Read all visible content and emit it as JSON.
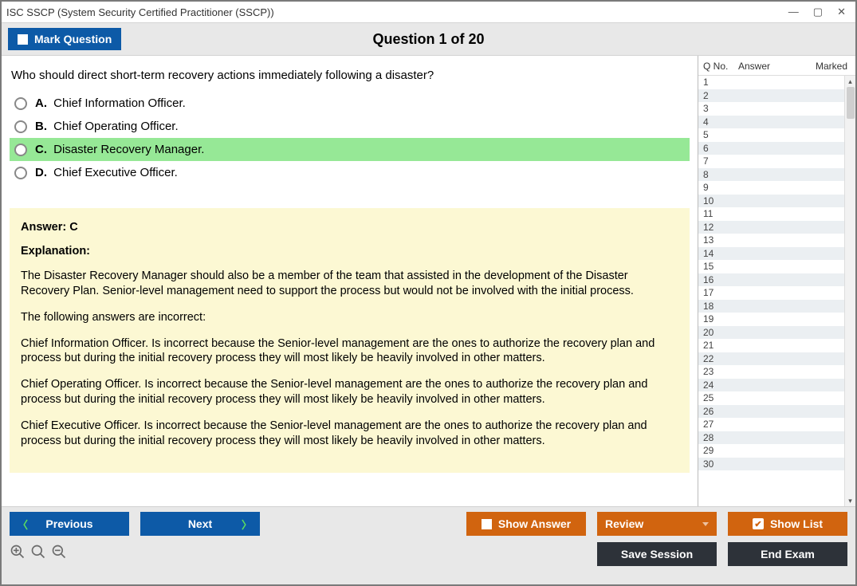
{
  "window": {
    "title": "ISC SSCP (System Security Certified Practitioner (SSCP))"
  },
  "toolbar": {
    "mark_label": "Mark Question",
    "header": "Question 1 of 20"
  },
  "question": {
    "text": "Who should direct short-term recovery actions immediately following a disaster?",
    "options": [
      {
        "letter": "A.",
        "text": "Chief Information Officer.",
        "highlight": false
      },
      {
        "letter": "B.",
        "text": "Chief Operating Officer.",
        "highlight": false
      },
      {
        "letter": "C.",
        "text": "Disaster Recovery Manager.",
        "highlight": true
      },
      {
        "letter": "D.",
        "text": "Chief Executive Officer.",
        "highlight": false
      }
    ]
  },
  "answer_panel": {
    "answer_line": "Answer: C",
    "explanation_label": "Explanation:",
    "paragraphs": [
      "The Disaster Recovery Manager should also be a member of the team that assisted in the development of the Disaster Recovery Plan. Senior-level management need to support the process but would not be involved with the initial process.",
      "The following answers are incorrect:",
      "Chief Information Officer. Is incorrect because the Senior-level management are the ones to authorize the recovery plan and process but during the initial recovery process they will most likely be heavily involved in other matters.",
      "Chief Operating Officer. Is incorrect because the Senior-level management are the ones to authorize the recovery plan and process but during the initial recovery process they will most likely be heavily involved in other matters.",
      "Chief Executive Officer. Is incorrect because the Senior-level management are the ones to authorize the recovery plan and process but during the initial recovery process they will most likely be heavily involved in other matters."
    ]
  },
  "sidepanel": {
    "headers": {
      "c1": "Q No.",
      "c2": "Answer",
      "c3": "Marked"
    },
    "count": 30
  },
  "footer": {
    "previous": "Previous",
    "next": "Next",
    "show_answer": "Show Answer",
    "review": "Review",
    "show_list": "Show List",
    "save_session": "Save Session",
    "end_exam": "End Exam"
  }
}
